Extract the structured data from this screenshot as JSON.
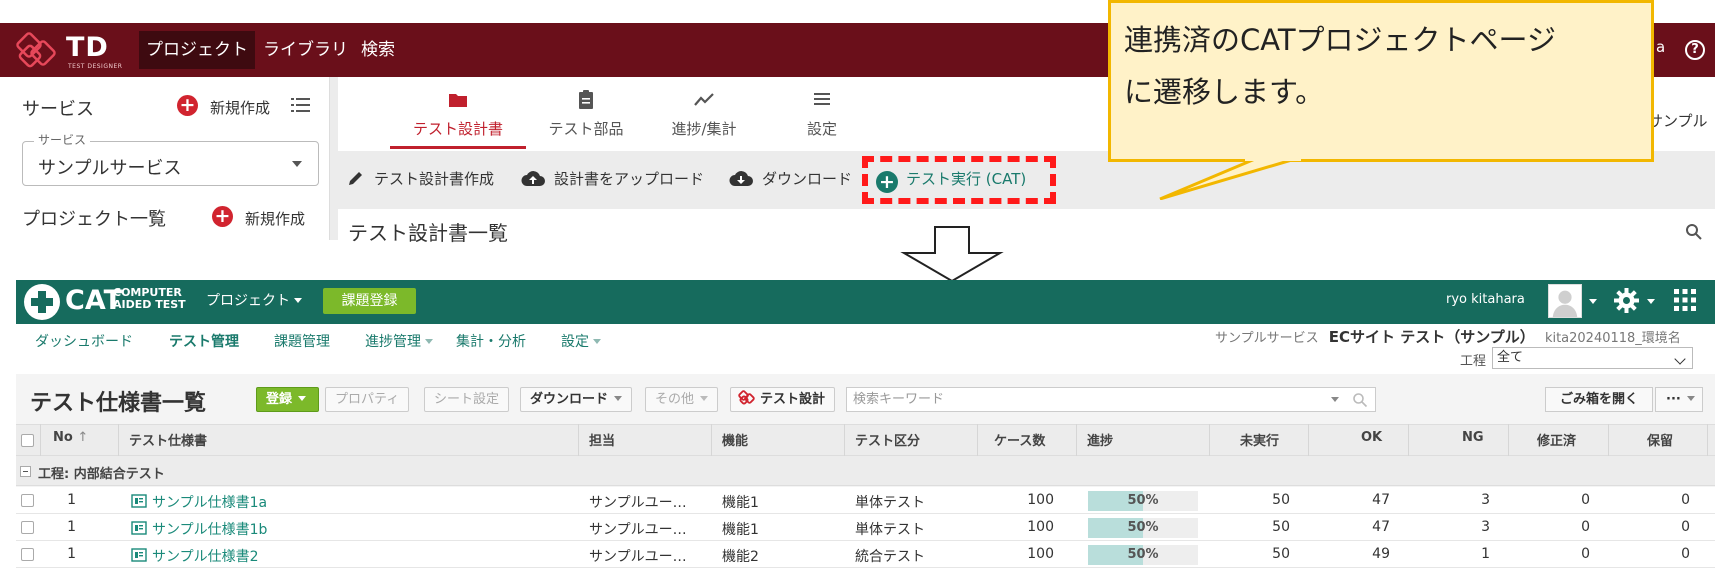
{
  "td": {
    "brand": "TD",
    "brand_sub": "TEST DESIGNER",
    "nav": [
      "プロジェクト",
      "ライブラリ",
      "検索"
    ],
    "user_tail": "a",
    "help": "?",
    "sidebar": {
      "service_title": "サービス",
      "new_label": "新規作成",
      "service_select_legend": "サービス",
      "service_select_value": "サンプルサービス",
      "project_list_title": "プロジェクト一覧",
      "project_new_label": "新規作成"
    },
    "tabs": [
      "テスト設計書",
      "テスト部品",
      "進捗/集計",
      "設定"
    ],
    "tail_text": "サンプル",
    "toolbar": {
      "create": "テスト設計書作成",
      "upload": "設計書をアップロード",
      "download": "ダウンロード",
      "cat": "テスト実行 (CAT)"
    },
    "list_title": "テスト設計書一覧"
  },
  "callout": {
    "line1": "連携済のCATプロジェクトページ",
    "line2": "に遷移します。"
  },
  "cat": {
    "logo_word": "CAT",
    "logo_sub1": "COMPUTER",
    "logo_sub2": "AIDED TEST",
    "project_menu": "プロジェクト",
    "issue_button": "課題登録",
    "user_name": "ryo kitahara",
    "subnav": [
      "ダッシュボード",
      "テスト管理",
      "課題管理",
      "進捗管理",
      "集計・分析",
      "設定"
    ],
    "breadcrumb": {
      "service": "サンプルサービス",
      "project": "ECサイト テスト（サンプル）",
      "env": "kita20240118_環境名"
    },
    "process_label": "工程",
    "process_value": "全て",
    "list_title": "テスト仕様書一覧",
    "buttons": {
      "register": "登録",
      "property": "プロパティ",
      "sheet": "シート設定",
      "download": "ダウンロード",
      "other": "その他",
      "test_design": "テスト設計",
      "trash": "ごみ箱を開く",
      "more": "···"
    },
    "search_placeholder": "検索キーワード",
    "columns": [
      "No",
      "テスト仕様書",
      "担当",
      "機能",
      "テスト区分",
      "ケース数",
      "進捗",
      "未実行",
      "OK",
      "NG",
      "修正済",
      "保留"
    ],
    "group_label": "工程: 内部結合テスト",
    "rows": [
      {
        "no": "1",
        "spec": "サンプル仕様書1a",
        "owner": "サンプルユー…",
        "feature": "機能1",
        "type": "単体テスト",
        "cases": "100",
        "progress": "50%",
        "progress_value": 0.5,
        "pending": "50",
        "ok": "47",
        "ng": "3",
        "fixed": "0",
        "hold": "0"
      },
      {
        "no": "1",
        "spec": "サンプル仕様書1b",
        "owner": "サンプルユー…",
        "feature": "機能1",
        "type": "単体テスト",
        "cases": "100",
        "progress": "50%",
        "progress_value": 0.5,
        "pending": "50",
        "ok": "47",
        "ng": "3",
        "fixed": "0",
        "hold": "0"
      },
      {
        "no": "1",
        "spec": "サンプル仕様書2",
        "owner": "サンプルユー…",
        "feature": "機能2",
        "type": "統合テスト",
        "cases": "100",
        "progress": "50%",
        "progress_value": 0.5,
        "pending": "50",
        "ok": "49",
        "ng": "1",
        "fixed": "0",
        "hold": "0"
      }
    ]
  },
  "colors": {
    "td_header": "#6a0f1a",
    "td_accent": "#c0202d",
    "highlight": "#ff1a1a",
    "callout_bg": "#fff2c8",
    "callout_border": "#f2b700",
    "cat_header": "#166b5d",
    "cat_green_button": "#7cb92a",
    "cat_link": "#1a7a6c"
  }
}
